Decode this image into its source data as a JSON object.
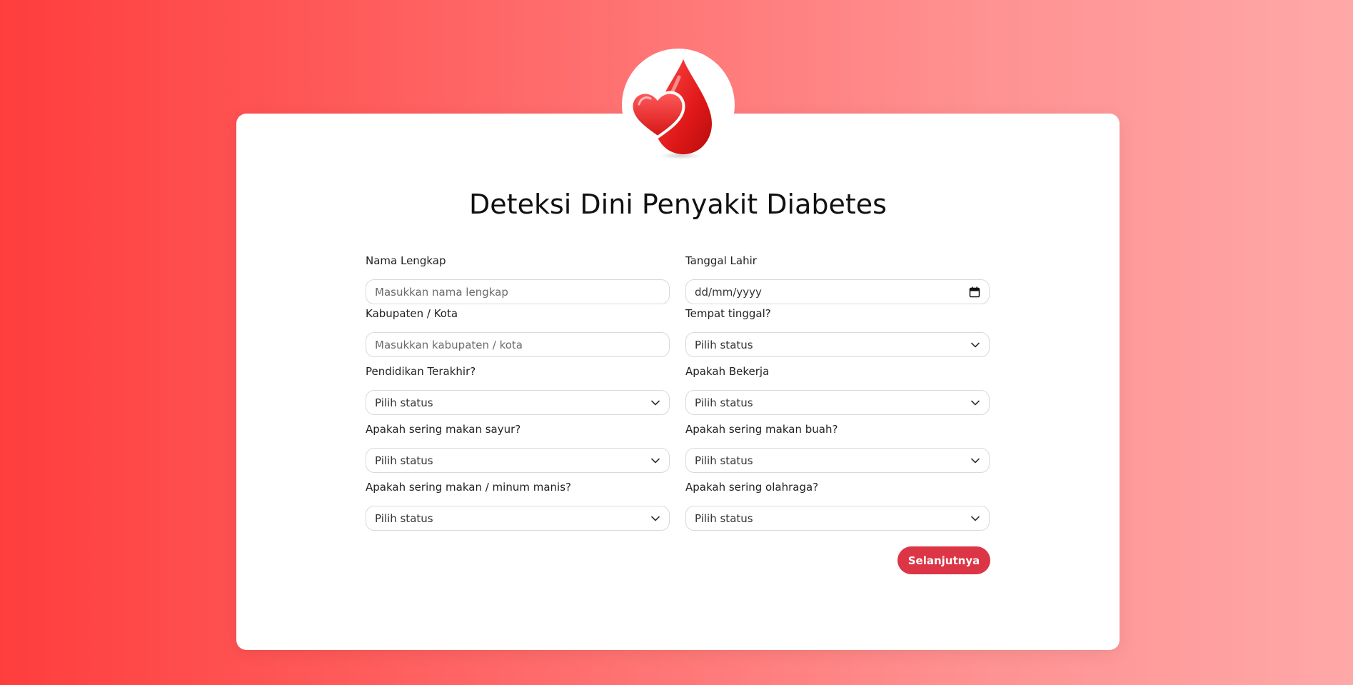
{
  "title": "Deteksi Dini Penyakit Diabetes",
  "colors": {
    "accent": "#dc3545",
    "bg_left": "#ff3d3d",
    "bg_right": "#ffa8a8"
  },
  "fields": {
    "nama": {
      "label": "Nama Lengkap",
      "placeholder": "Masukkan nama lengkap"
    },
    "tanggal": {
      "label": "Tanggal Lahir",
      "value": "dd/mm/yyyy",
      "icon": "calendar-icon"
    },
    "kabupaten": {
      "label": "Kabupaten / Kota",
      "placeholder": "Masukkan kabupaten / kota"
    },
    "tempat": {
      "label": "Tempat tinggal?",
      "value": "Pilih status"
    },
    "pendidikan": {
      "label": "Pendidikan Terakhir?",
      "value": "Pilih status"
    },
    "bekerja": {
      "label": "Apakah Bekerja",
      "value": "Pilih status"
    },
    "sayur": {
      "label": "Apakah sering makan sayur?",
      "value": "Pilih status"
    },
    "buah": {
      "label": "Apakah sering makan buah?",
      "value": "Pilih status"
    },
    "manis": {
      "label": "Apakah sering makan / minum manis?",
      "value": "Pilih status"
    },
    "olahraga": {
      "label": "Apakah sering olahraga?",
      "value": "Pilih status"
    }
  },
  "submit_label": "Selanjutnya"
}
